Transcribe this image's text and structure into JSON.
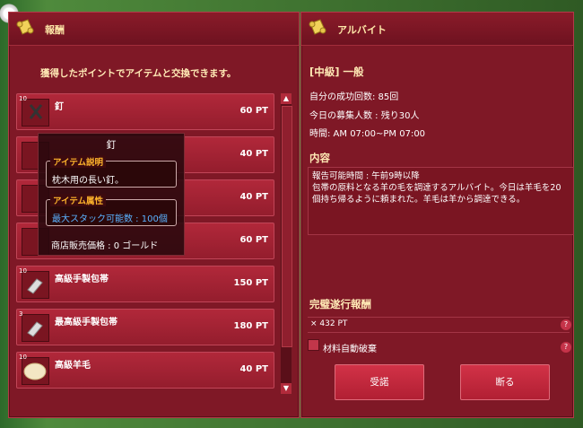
{
  "left_panel": {
    "title": "報酬",
    "intro": "獲得したポイントでアイテムと交換できます。",
    "items": [
      {
        "qty": "10",
        "name": "釘",
        "price": "60 PT"
      },
      {
        "qty": "",
        "name": "",
        "price": "40 PT"
      },
      {
        "qty": "",
        "name": "",
        "price": "40 PT"
      },
      {
        "qty": "",
        "name": "",
        "price": "60 PT"
      },
      {
        "qty": "10",
        "name": "高級手製包帯",
        "price": "150 PT"
      },
      {
        "qty": "3",
        "name": "最高級手製包帯",
        "price": "180 PT"
      },
      {
        "qty": "10",
        "name": "高級羊毛",
        "price": "40 PT"
      }
    ]
  },
  "tooltip": {
    "title": "釘",
    "desc_label": "アイテム説明",
    "desc_text": "枕木用の長い釘。",
    "attr_label": "アイテム属性",
    "attr_text": "最大スタック可能数 : 100個",
    "sell_text": "商店販売価格 : 0 ゴールド"
  },
  "right_panel": {
    "title": "アルバイト",
    "rank": "[中級] 一般",
    "success_count": "自分の成功回数: 85回",
    "recruit_today": "今日の募集人数 : 残り30人",
    "time": "時間: AM 07:00~PM 07:00",
    "content_head": "内容",
    "content_text": "報告可能時間 : 午前9時以降\n包帯の原料となる羊の毛を調達するアルバイト。今日は羊毛を20個持ち帰るように頼まれた。羊毛は羊から調達できる。",
    "reward_head": "完璧遂行報酬",
    "reward_value": "× 432 PT",
    "auto_discard": "材料自動破棄",
    "accept_button": "受諾",
    "decline_button": "断る"
  }
}
